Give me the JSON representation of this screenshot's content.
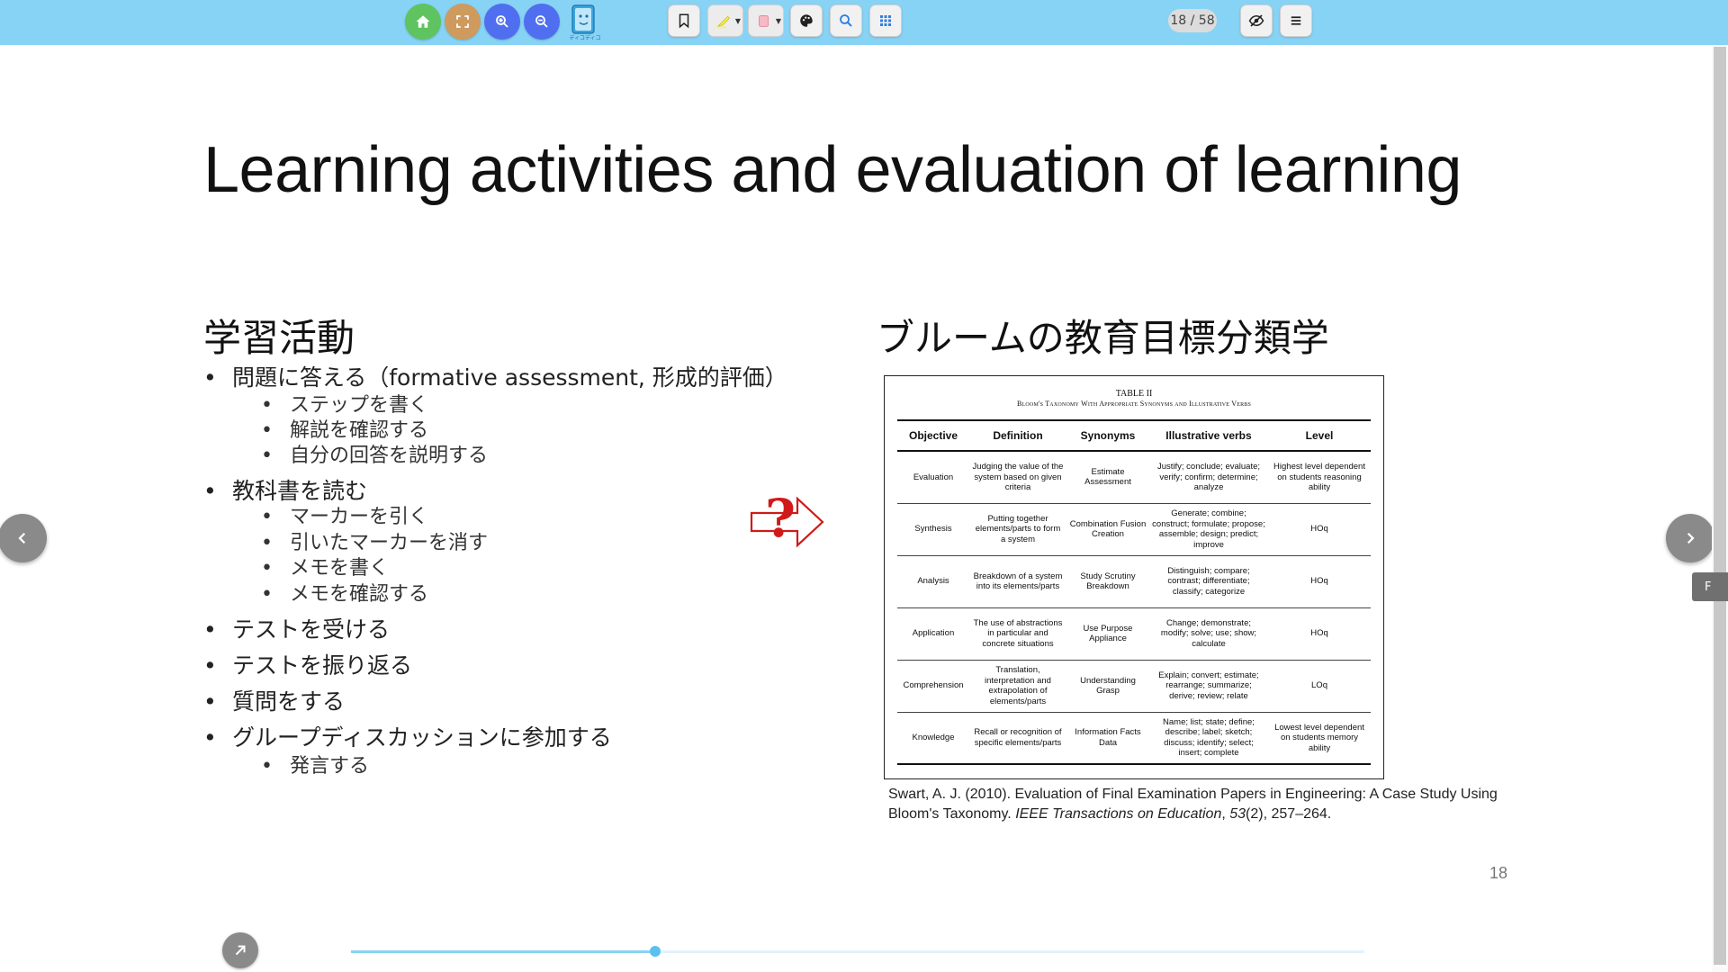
{
  "toolbar": {
    "page_indicator": "18 / 58",
    "logo_caption": "ディコディコ",
    "colors": {
      "bar": "#87d3f5",
      "home": "#5fc35f",
      "fullscreen": "#cf9a5e",
      "zoom": "#4f6ff0"
    }
  },
  "slide": {
    "title": "Learning activities and evaluation of learning",
    "left_heading": "学習活動",
    "right_heading": "ブルームの教育目標分類学",
    "bullet_mark": "•",
    "bullets": [
      {
        "text": "問題に答える（formative assessment, 形成的評価）",
        "children": [
          "ステップを書く",
          "解説を確認する",
          "自分の回答を説明する"
        ]
      },
      {
        "text": "教科書を読む",
        "children": [
          "マーカーを引く",
          "引いたマーカーを消す",
          "メモを書く",
          "メモを確認する"
        ]
      },
      {
        "text": "テストを受ける",
        "children": []
      },
      {
        "text": "テストを振り返る",
        "children": []
      },
      {
        "text": "質問をする",
        "children": []
      },
      {
        "text": "グループディスカッションに参加する",
        "children": [
          "発言する"
        ]
      }
    ],
    "table": {
      "title": "TABLE II",
      "subtitle": "Bloom's Taxonomy With Appropriate Synonyms and Illustrative Verbs",
      "headers": [
        "Objective",
        "Definition",
        "Synonyms",
        "Illustrative verbs",
        "Level"
      ],
      "rows": [
        [
          "Evaluation",
          "Judging the value of the system based on given criteria",
          "Estimate Assessment",
          "Justify; conclude; evaluate; verify; confirm; determine; analyze",
          "Highest level dependent on students reasoning ability"
        ],
        [
          "Synthesis",
          "Putting together elements/parts to form a system",
          "Combination Fusion Creation",
          "Generate; combine; construct; formulate; propose; assemble; design; predict; improve",
          "HOq"
        ],
        [
          "Analysis",
          "Breakdown of a system into its elements/parts",
          "Study Scrutiny Breakdown",
          "Distinguish; compare; contrast; differentiate; classify; categorize",
          "HOq"
        ],
        [
          "Application",
          "The use of abstractions in particular and concrete situations",
          "Use Purpose Appliance",
          "Change; demonstrate; modify; solve; use; show; calculate",
          "HOq"
        ],
        [
          "Comprehension",
          "Translation, interpretation and extrapolation of elements/parts",
          "Understanding Grasp",
          "Explain; convert; estimate; rearrange; summarize; derive; review; relate",
          "LOq"
        ],
        [
          "Knowledge",
          "Recall or recognition of specific elements/parts",
          "Information Facts Data",
          "Name; list; state; define; describe; label; sketch; discuss; identify; select; insert; complete",
          "Lowest level dependent on students memory ability"
        ]
      ]
    },
    "citation_line1": "Swart, A. J. (2010). Evaluation of Final Examination Papers in Engineering: A Case Study Using",
    "citation_line2_pre": "Bloom's Taxonomy. ",
    "citation_journal": "IEEE Transactions on Education",
    "citation_sep": ", ",
    "citation_volume": "53",
    "citation_tail": "(2), 257–264.",
    "slide_number": "18",
    "arrow_symbol": "?"
  },
  "nav": {
    "prev_symbol": "‹",
    "next_symbol": "›",
    "side_tab_label": "F",
    "progress_fraction": 0.3
  }
}
